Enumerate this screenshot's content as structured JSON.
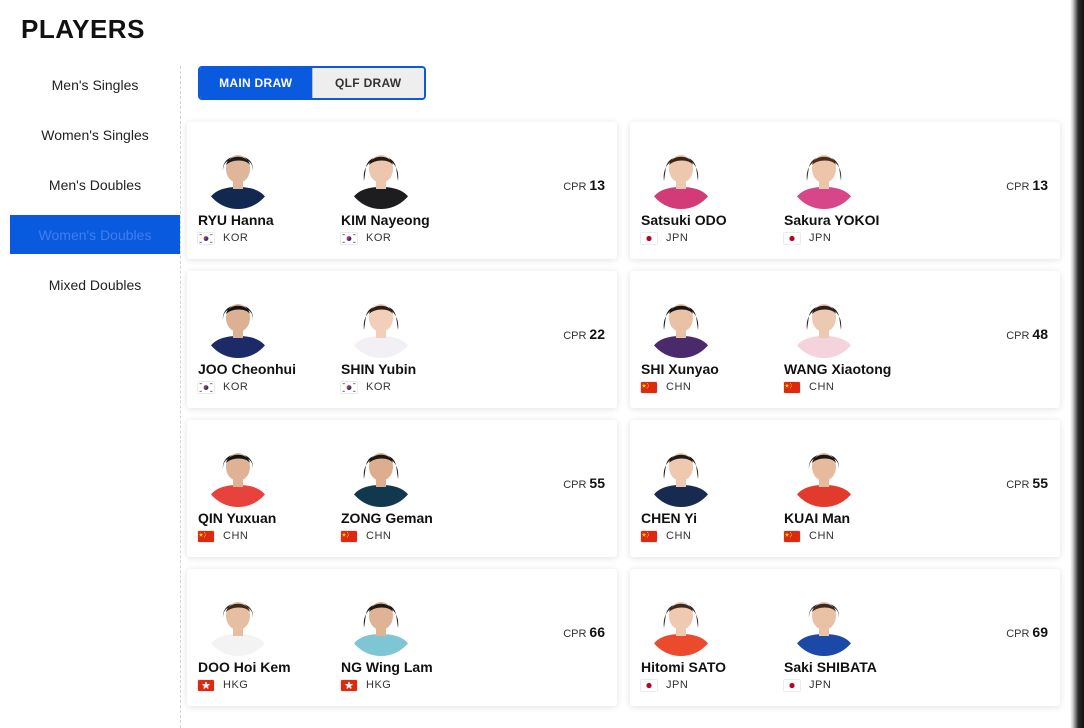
{
  "page": {
    "title": "PLAYERS"
  },
  "sidebar": {
    "items": [
      {
        "label": "Men's Singles",
        "active": false
      },
      {
        "label": "Women's Singles",
        "active": false
      },
      {
        "label": "Men's Doubles",
        "active": false
      },
      {
        "label": "Women's Doubles",
        "active": true
      },
      {
        "label": "Mixed Doubles",
        "active": false
      }
    ]
  },
  "tabs": {
    "main_draw": "MAIN DRAW",
    "qlf_draw": "QLF DRAW",
    "active": "main_draw"
  },
  "cpr_label": "CPR",
  "pairs": [
    {
      "cpr": "13",
      "players": [
        {
          "name": "RYU Hanna",
          "country": "KOR",
          "skin": "#e0b69a",
          "hair": "#1b1b1b",
          "shirt": "#13284f",
          "short_hair": true
        },
        {
          "name": "KIM Nayeong",
          "country": "KOR",
          "skin": "#ecc6ad",
          "hair": "#221a15",
          "shirt": "#1d1d1f",
          "short_hair": false
        }
      ]
    },
    {
      "cpr": "13",
      "players": [
        {
          "name": "Satsuki ODO",
          "country": "JPN",
          "skin": "#eec8ae",
          "hair": "#3a2418",
          "shirt": "#d23b78",
          "short_hair": false
        },
        {
          "name": "Sakura YOKOI",
          "country": "JPN",
          "skin": "#edc5a9",
          "hair": "#4a2d1c",
          "shirt": "#d8468a",
          "short_hair": false
        }
      ]
    },
    {
      "cpr": "22",
      "players": [
        {
          "name": "JOO Cheonhui",
          "country": "KOR",
          "skin": "#dcb093",
          "hair": "#141414",
          "shirt": "#1c2a68",
          "short_hair": true
        },
        {
          "name": "SHIN Yubin",
          "country": "KOR",
          "skin": "#f1cfb8",
          "hair": "#2b2019",
          "shirt": "#f2f0f5",
          "short_hair": false
        }
      ]
    },
    {
      "cpr": "48",
      "players": [
        {
          "name": "SHI Xunyao",
          "country": "CHN",
          "skin": "#e8c1a6",
          "hair": "#1a1512",
          "shirt": "#4a2a6b",
          "short_hair": false
        },
        {
          "name": "WANG Xiaotong",
          "country": "CHN",
          "skin": "#ecc9b2",
          "hair": "#2a211b",
          "shirt": "#f4d3dc",
          "short_hair": false
        }
      ]
    },
    {
      "cpr": "55",
      "players": [
        {
          "name": "QIN Yuxuan",
          "country": "CHN",
          "skin": "#dfb295",
          "hair": "#131313",
          "shirt": "#e8423c",
          "short_hair": true
        },
        {
          "name": "ZONG Geman",
          "country": "CHN",
          "skin": "#dcae8f",
          "hair": "#1d1612",
          "shirt": "#12384e",
          "short_hair": false
        }
      ]
    },
    {
      "cpr": "55",
      "players": [
        {
          "name": "CHEN Yi",
          "country": "CHN",
          "skin": "#eec9b0",
          "hair": "#1e1a17",
          "shirt": "#172a4f",
          "short_hair": false
        },
        {
          "name": "KUAI Man",
          "country": "CHN",
          "skin": "#e6bb9d",
          "hair": "#1a1614",
          "shirt": "#e23a2d",
          "short_hair": true
        }
      ]
    },
    {
      "cpr": "66",
      "players": [
        {
          "name": "DOO Hoi Kem",
          "country": "HKG",
          "skin": "#e6bfa3",
          "hair": "#3a2a1e",
          "shirt": "#f3f3f3",
          "short_hair": true
        },
        {
          "name": "NG Wing Lam",
          "country": "HKG",
          "skin": "#dfb394",
          "hair": "#1e1712",
          "shirt": "#7ec6d4",
          "short_hair": false
        }
      ]
    },
    {
      "cpr": "69",
      "players": [
        {
          "name": "Hitomi SATO",
          "country": "JPN",
          "skin": "#efcab0",
          "hair": "#3a2a1f",
          "shirt": "#ec4a2c",
          "short_hair": false
        },
        {
          "name": "Saki SHIBATA",
          "country": "JPN",
          "skin": "#e9c2a6",
          "hair": "#3b2a1d",
          "shirt": "#1c49a8",
          "short_hair": true
        }
      ]
    }
  ],
  "colors": {
    "accent": "#0a5ae0",
    "kor_flag": "#ffffff",
    "jpn_flag": "#ffffff",
    "chn_flag": "#de2910",
    "hkg_flag": "#de2910"
  }
}
